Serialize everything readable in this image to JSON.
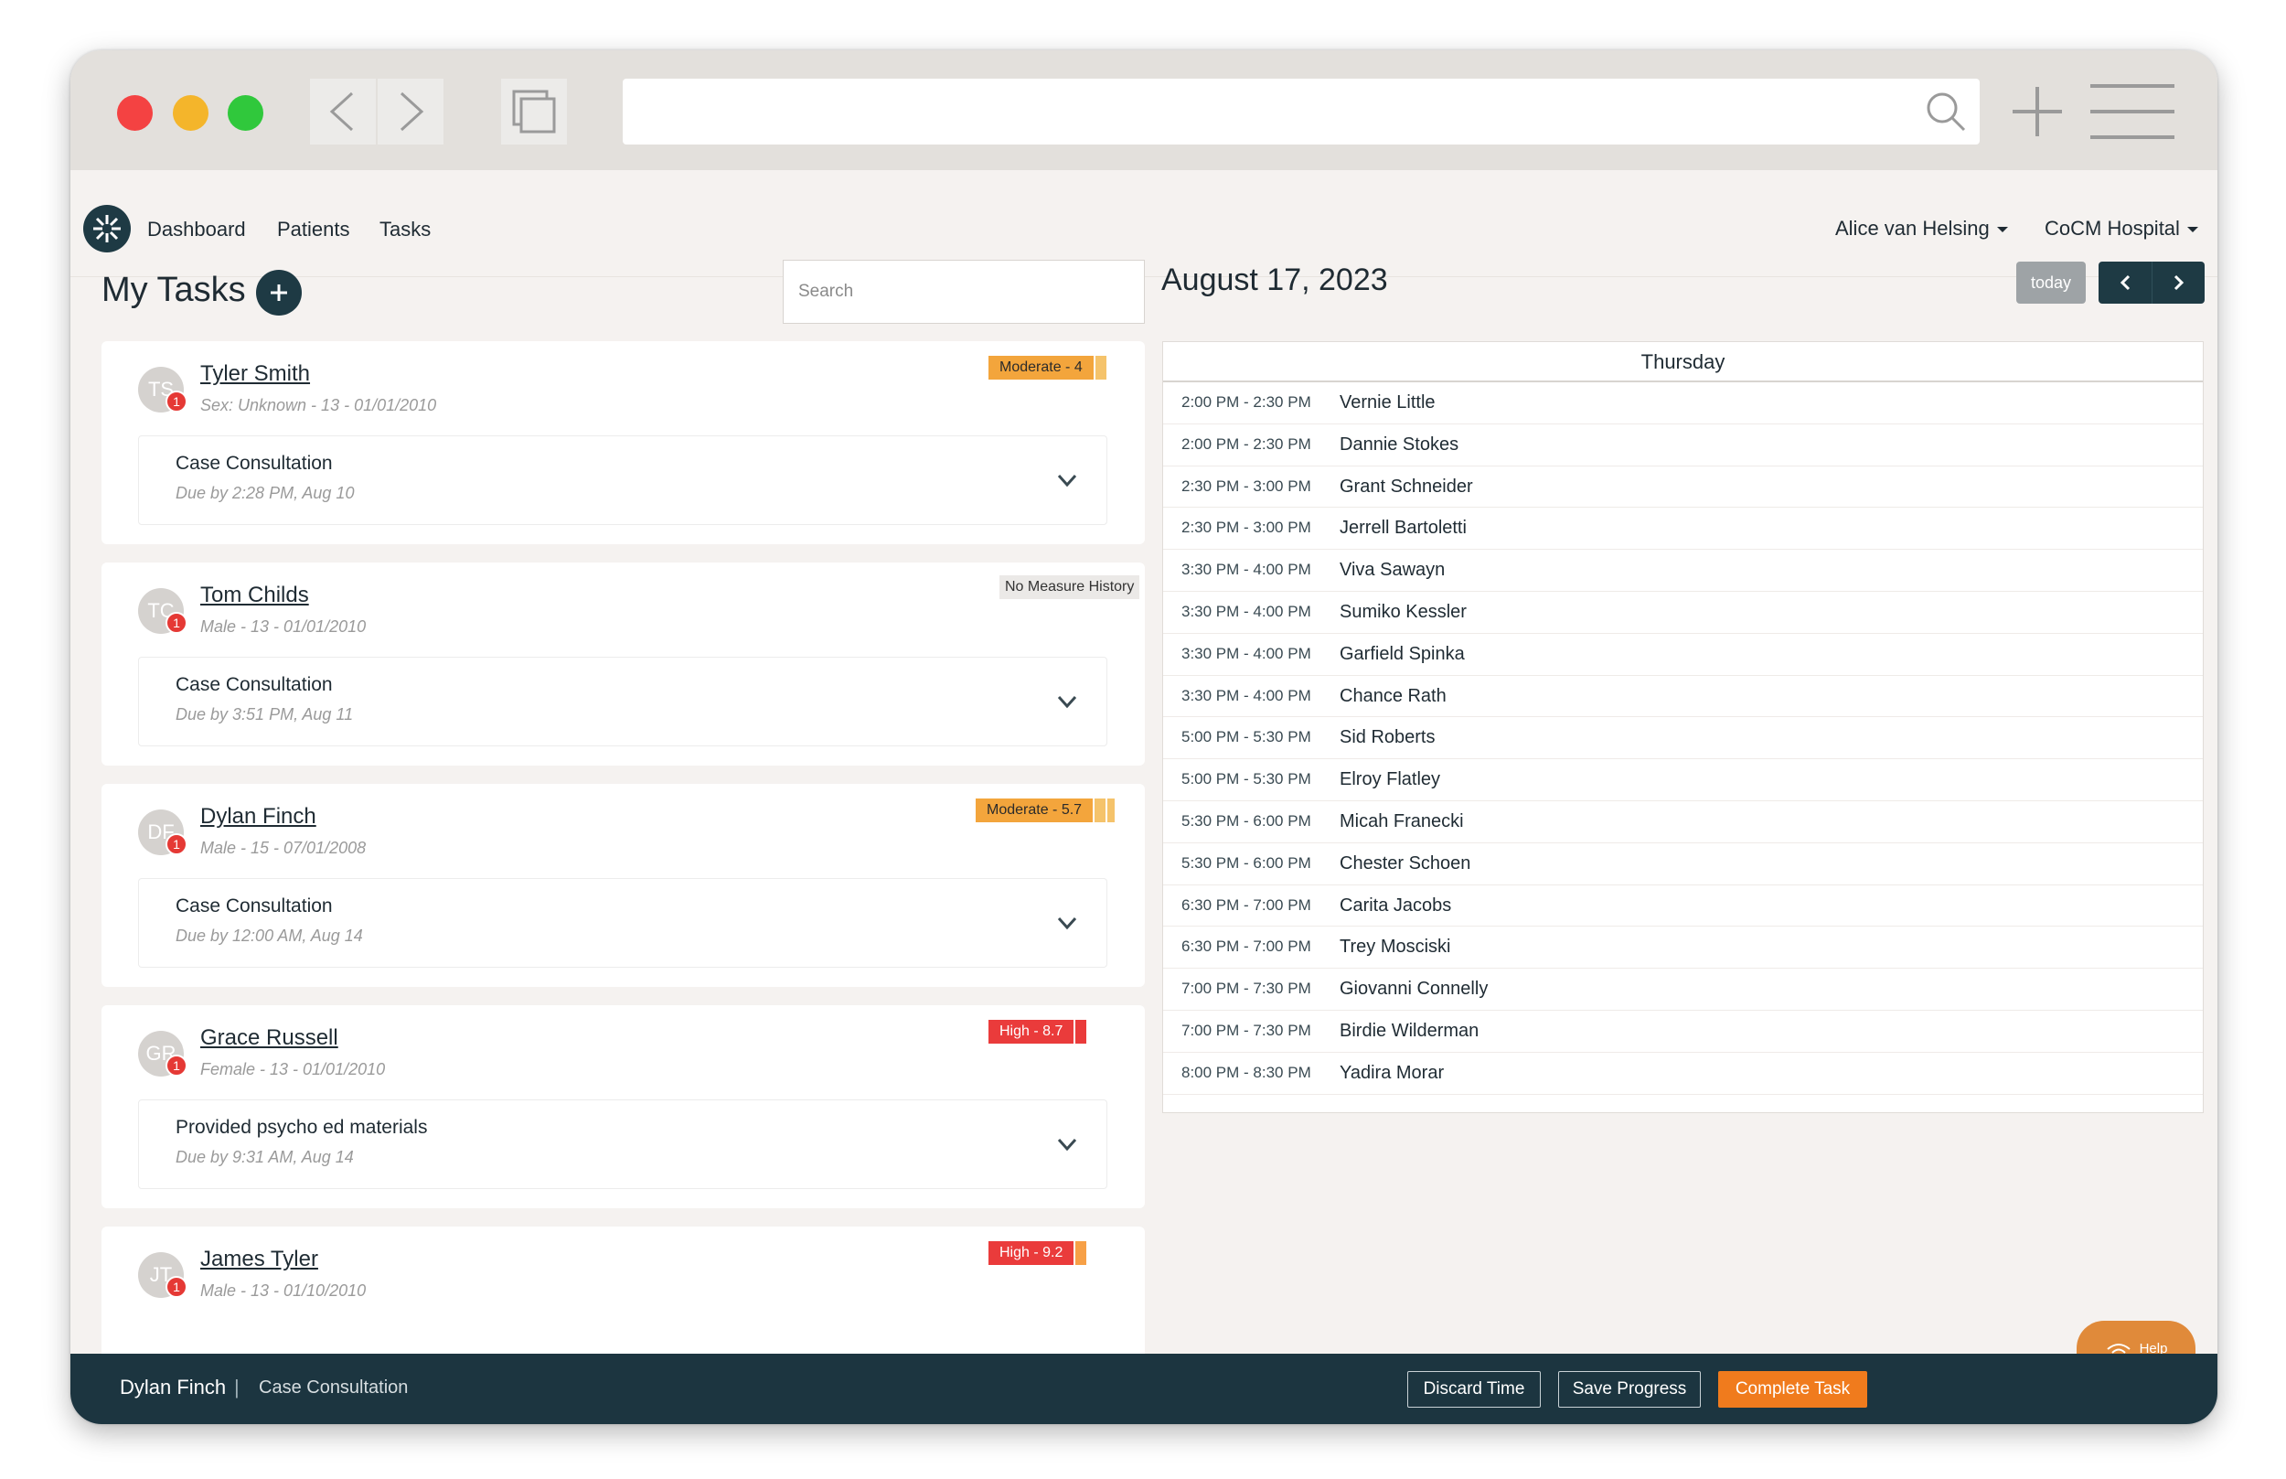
{
  "browser": {
    "url": "",
    "icons": [
      "back-icon",
      "forward-icon",
      "tabs-icon",
      "search-icon",
      "new-tab-icon",
      "menu-icon"
    ]
  },
  "nav": {
    "links": [
      "Dashboard",
      "Patients",
      "Tasks"
    ],
    "user": "Alice van Helsing",
    "org": "CoCM Hospital"
  },
  "tasks": {
    "title": "My Tasks",
    "search_placeholder": "Search",
    "cards": [
      {
        "initials": "TS",
        "alerts": "1",
        "name": "Tyler Smith",
        "meta": "Sex: Unknown - 13 - 01/01/2010",
        "badge": "Moderate - 4",
        "badge_level": "moderate",
        "task": "Case Consultation",
        "due": "Due by 2:28 PM, Aug 10"
      },
      {
        "initials": "TC",
        "alerts": "1",
        "name": "Tom Childs",
        "meta": "Male - 13 - 01/01/2010",
        "badge": "No Measure History",
        "badge_level": "none",
        "task": "Case Consultation",
        "due": "Due by 3:51 PM, Aug 11"
      },
      {
        "initials": "DF",
        "alerts": "1",
        "name": "Dylan Finch",
        "meta": "Male - 15 - 07/01/2008",
        "badge": "Moderate - 5.7",
        "badge_level": "moderate",
        "task": "Case Consultation",
        "due": "Due by 12:00 AM, Aug 14"
      },
      {
        "initials": "GR",
        "alerts": "1",
        "name": "Grace Russell",
        "meta": "Female - 13 - 01/01/2010",
        "badge": "High - 8.7",
        "badge_level": "high",
        "task": "Provided psycho ed materials",
        "due": "Due by 9:31 AM, Aug 14"
      },
      {
        "initials": "JT",
        "alerts": "1",
        "name": "James Tyler",
        "meta": "Male - 13 - 01/10/2010",
        "badge": "High - 9.2",
        "badge_level": "high",
        "task": "",
        "due": ""
      }
    ]
  },
  "calendar": {
    "date": "August 17, 2023",
    "today_label": "today",
    "day": "Thursday",
    "events": [
      {
        "time": "2:00 PM - 2:30 PM",
        "name": "Vernie Little"
      },
      {
        "time": "2:00 PM - 2:30 PM",
        "name": "Dannie Stokes"
      },
      {
        "time": "2:30 PM - 3:00 PM",
        "name": "Grant Schneider"
      },
      {
        "time": "2:30 PM - 3:00 PM",
        "name": "Jerrell Bartoletti"
      },
      {
        "time": "3:30 PM - 4:00 PM",
        "name": "Viva Sawayn"
      },
      {
        "time": "3:30 PM - 4:00 PM",
        "name": "Sumiko Kessler"
      },
      {
        "time": "3:30 PM - 4:00 PM",
        "name": "Garfield Spinka"
      },
      {
        "time": "3:30 PM - 4:00 PM",
        "name": "Chance Rath"
      },
      {
        "time": "5:00 PM - 5:30 PM",
        "name": "Sid Roberts"
      },
      {
        "time": "5:00 PM - 5:30 PM",
        "name": "Elroy Flatley"
      },
      {
        "time": "5:30 PM - 6:00 PM",
        "name": "Micah Franecki"
      },
      {
        "time": "5:30 PM - 6:00 PM",
        "name": "Chester Schoen"
      },
      {
        "time": "6:30 PM - 7:00 PM",
        "name": "Carita Jacobs"
      },
      {
        "time": "6:30 PM - 7:00 PM",
        "name": "Trey Mosciski"
      },
      {
        "time": "7:00 PM - 7:30 PM",
        "name": "Giovanni Connelly"
      },
      {
        "time": "7:00 PM - 7:30 PM",
        "name": "Birdie Wilderman"
      },
      {
        "time": "8:00 PM - 8:30 PM",
        "name": "Yadira Morar"
      }
    ]
  },
  "help": {
    "label": "Help"
  },
  "footer": {
    "patient": "Dylan Finch",
    "separator": "|",
    "task": "Case Consultation",
    "discard": "Discard Time",
    "save": "Save Progress",
    "complete": "Complete Task"
  },
  "colors": {
    "brand_dark": "#1c3540",
    "accent_orange": "#f07b1d",
    "moderate": "#f3a53c",
    "high": "#ea3b3b",
    "alert": "#e53935"
  }
}
